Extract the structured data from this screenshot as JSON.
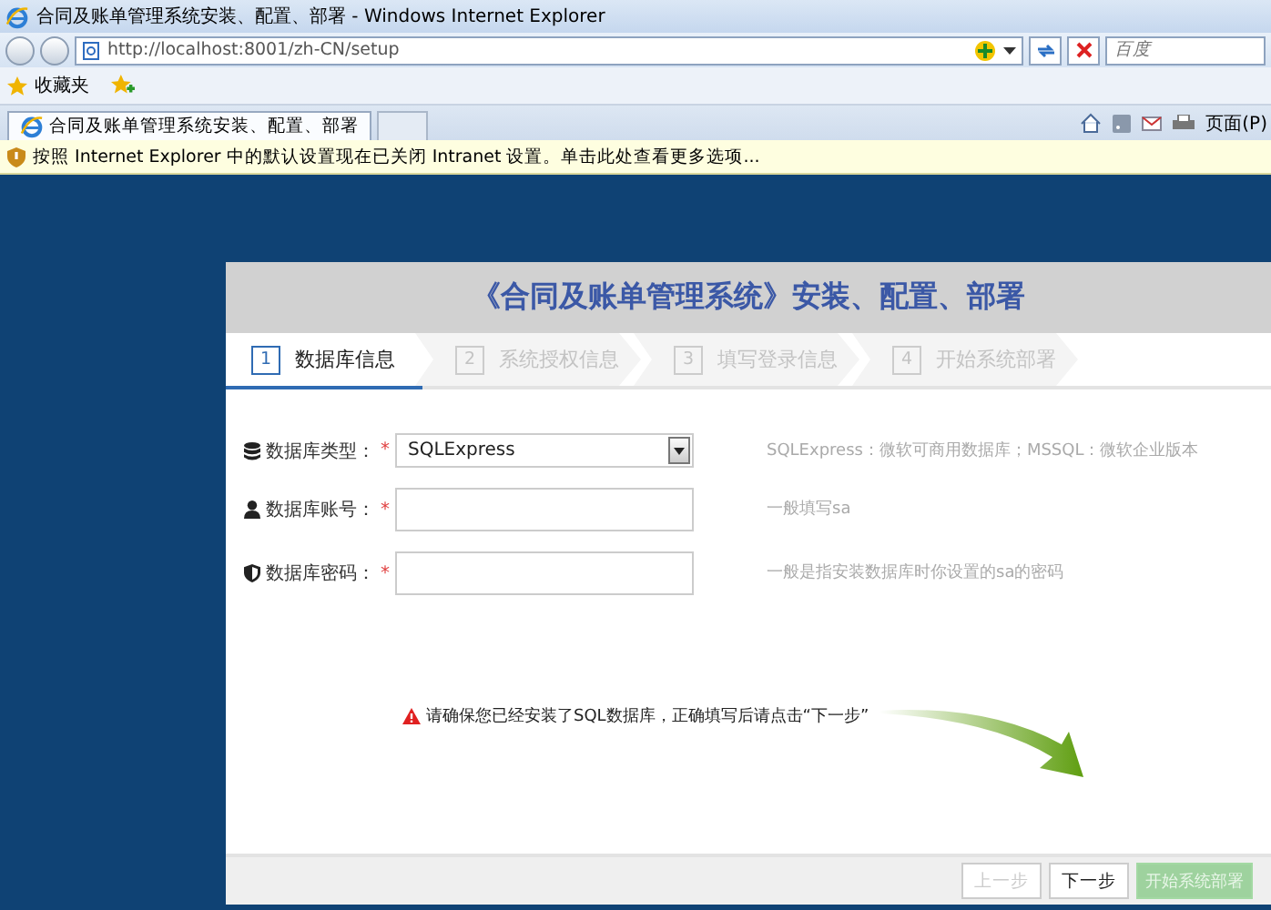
{
  "window": {
    "title": "合同及账单管理系统安装、配置、部署 - Windows Internet Explorer"
  },
  "address_bar": {
    "url": "http://localhost:8001/zh-CN/setup",
    "search_placeholder": "百度"
  },
  "favorites_bar": {
    "label": "收藏夹"
  },
  "tabs": [
    {
      "label": "合同及账单管理系统安装、配置、部署",
      "selected": true
    }
  ],
  "command_bar": {
    "page_menu": "页面(P)"
  },
  "info_bar": {
    "text": "按照 Internet Explorer 中的默认设置现在已关闭 Intranet 设置。单击此处查看更多选项..."
  },
  "setup": {
    "title": "《合同及账单管理系统》安装、配置、部署",
    "steps": [
      {
        "number": "1",
        "label": "数据库信息",
        "selected": true
      },
      {
        "number": "2",
        "label": "系统授权信息",
        "selected": false
      },
      {
        "number": "3",
        "label": "填写登录信息",
        "selected": false
      },
      {
        "number": "4",
        "label": "开始系统部署",
        "selected": false
      }
    ],
    "fields": [
      {
        "kind": "select",
        "label": "数据库类型：",
        "required_mark": "*",
        "value": "SQLExpress",
        "hint": "SQLExpress：微软可商用数据库；MSSQL：微软企业版本"
      },
      {
        "kind": "text",
        "label": "数据库账号：",
        "required_mark": "*",
        "hint": "一般填写sa"
      },
      {
        "kind": "text",
        "label": "数据库密码：",
        "required_mark": "*",
        "hint": "一般是指安装数据库时你设置的sa的密码"
      }
    ],
    "notice": "请确保您已经安装了SQL数据库，正确填写后请点击“下一步”",
    "buttons": [
      {
        "label": "上一步",
        "kind": "default",
        "disabled": true
      },
      {
        "label": "下一步",
        "kind": "default",
        "disabled": false
      },
      {
        "label": "开始系统部署",
        "kind": "primary",
        "disabled": true
      }
    ]
  }
}
